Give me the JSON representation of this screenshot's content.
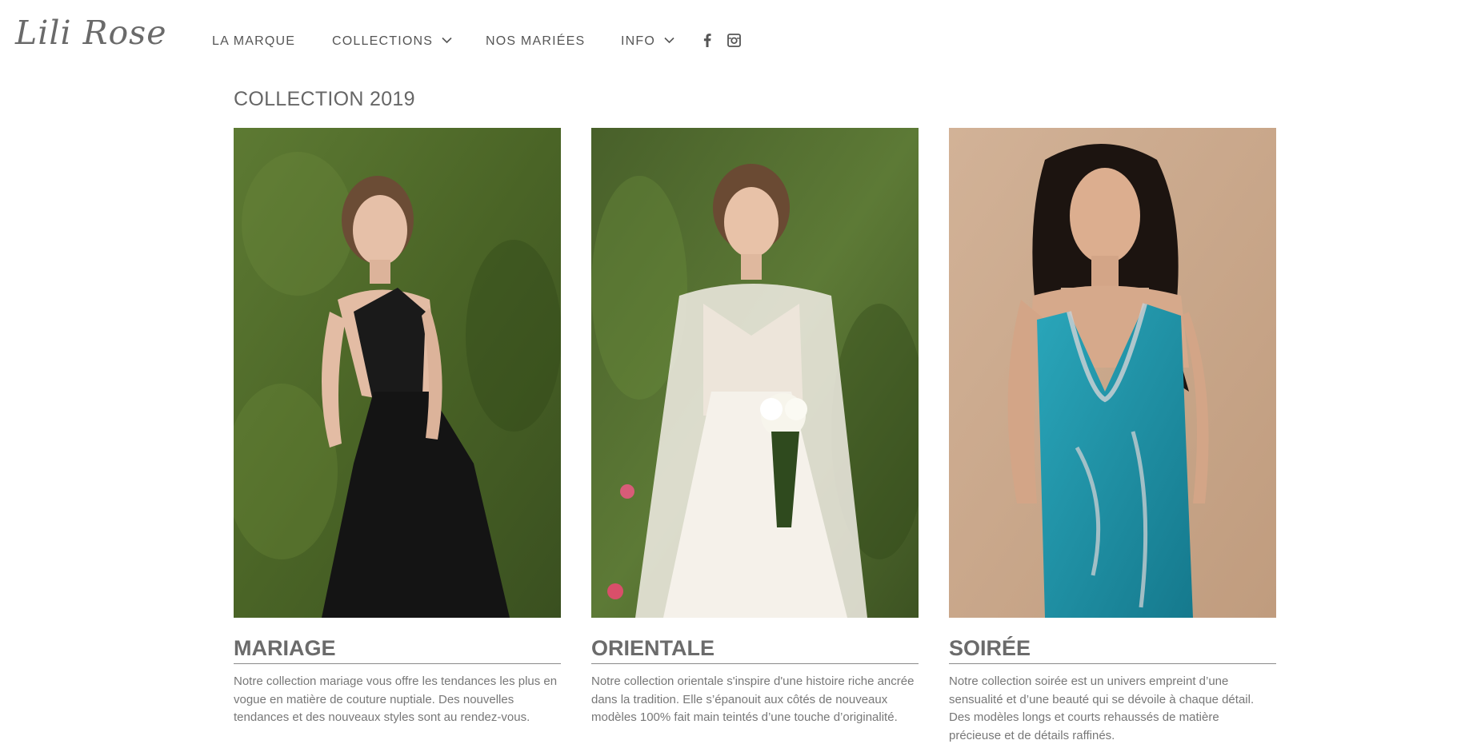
{
  "brand": {
    "logo_text": "Lili Rose"
  },
  "nav": {
    "items": [
      {
        "label": "LA MARQUE",
        "has_dropdown": false
      },
      {
        "label": "COLLECTIONS",
        "has_dropdown": true
      },
      {
        "label": "NOS MARIÉES",
        "has_dropdown": false
      },
      {
        "label": "INFO",
        "has_dropdown": true
      }
    ],
    "social": [
      "facebook-icon",
      "instagram-icon"
    ]
  },
  "main": {
    "title": "COLLECTION 2019",
    "cards": [
      {
        "title": "MARIAGE",
        "image": "woman-in-black-gown-photo",
        "description": "Notre collection mariage vous offre les tendances les plus en vogue en matière de couture nuptiale. Des nouvelles tendances et des nouveaux styles sont au rendez-vous."
      },
      {
        "title": "ORIENTALE",
        "image": "bride-in-white-gown-photo",
        "description": "Notre collection orientale s'inspire d'une histoire riche ancrée dans la tradition. Elle s’épanouit aux côtés de nouveaux modèles 100% fait main teintés d’une touche d’originalité."
      },
      {
        "title": "SOIRÉE",
        "image": "woman-in-blue-dress-photo",
        "description": "Notre collection soirée est un univers empreint d’une sensualité et d’une beauté qui se dévoile à chaque détail. Des modèles longs et courts rehaussés de matière précieuse et de détails raffinés."
      }
    ]
  },
  "colors": {
    "text": "#6b6b6b",
    "nav_text": "#555555",
    "background": "#ffffff",
    "garden_green": "#4f6a2c",
    "studio_beige": "#c9a789",
    "satin_blue": "#1e93a8"
  }
}
